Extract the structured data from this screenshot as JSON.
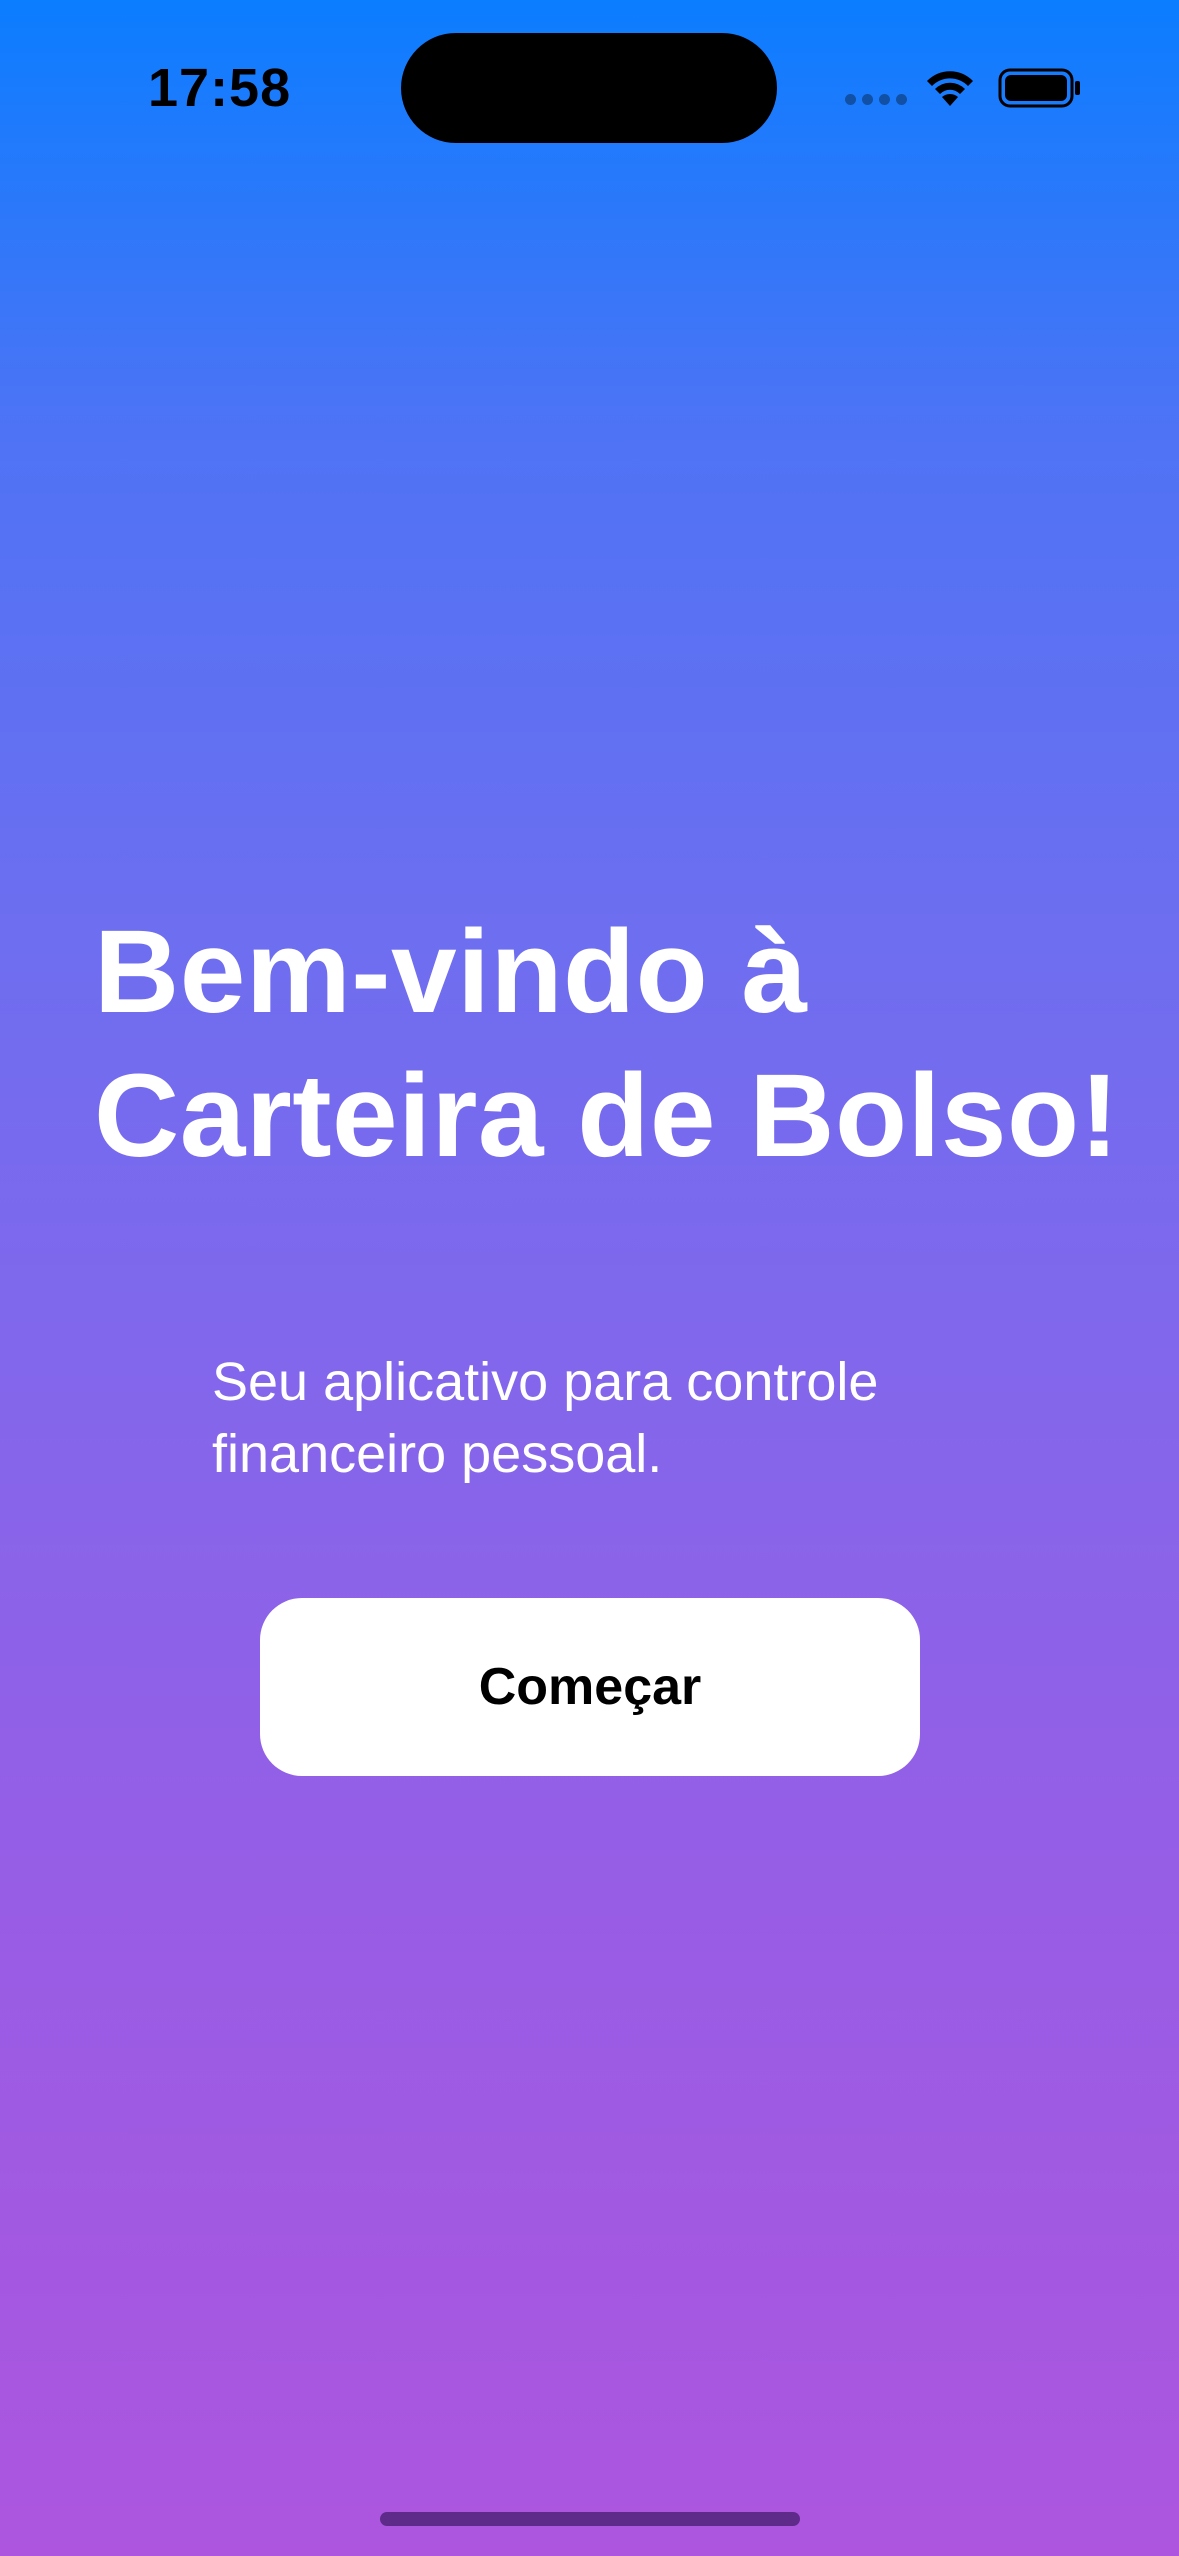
{
  "status_bar": {
    "time": "17:58",
    "icons": [
      "signal-dots-icon",
      "wifi-icon",
      "battery-icon"
    ]
  },
  "welcome": {
    "title_line1": "Bem-vindo à",
    "title_line2": "Carteira de Bolso!",
    "subtitle_line1": "Seu aplicativo para controle",
    "subtitle_line2": "financeiro pessoal.",
    "start_button_label": "Começar"
  },
  "colors": {
    "gradient_top": "#0b7dff",
    "gradient_bottom": "#ad55df",
    "button_background": "#ffffff",
    "text_light": "#ffffff",
    "text_dark": "#000000"
  }
}
